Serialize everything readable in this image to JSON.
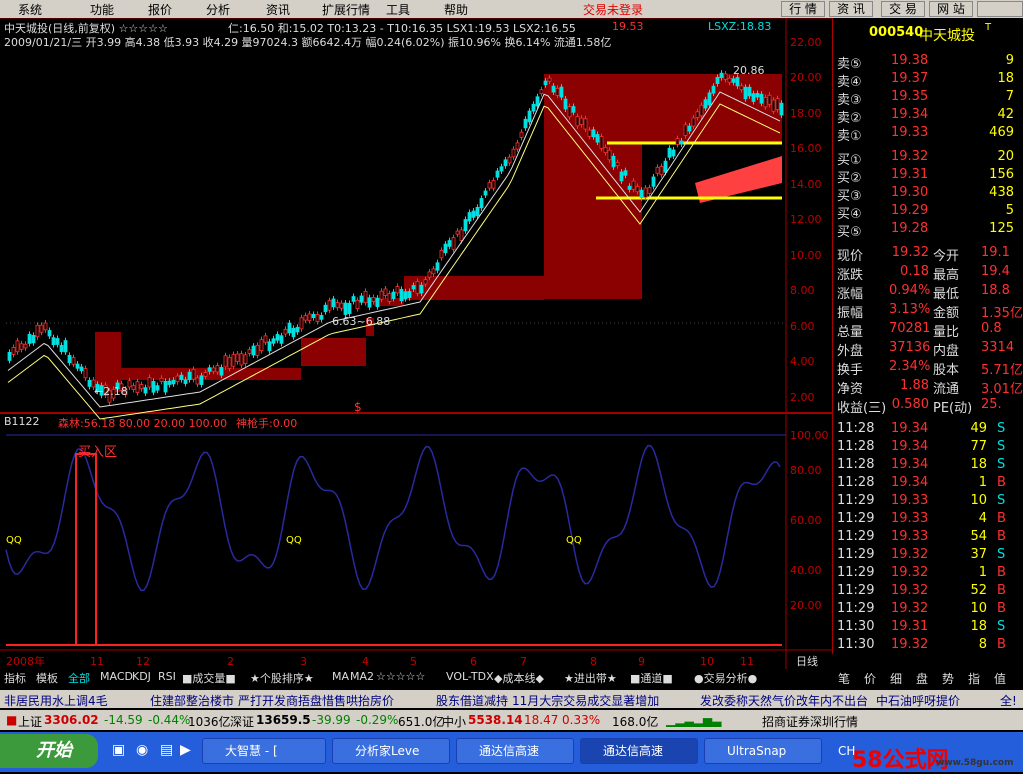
{
  "menu": {
    "items": [
      "系统",
      "功能",
      "报价",
      "分析",
      "资讯",
      "扩展行情",
      "工具",
      "帮助"
    ],
    "status": "交易未登录",
    "nav": [
      "行 情",
      "资 讯",
      "交 易",
      "网 站"
    ]
  },
  "header": {
    "line1": "中天城投(日线,前复权) ☆☆☆☆☆",
    "ma_line": "仁:16.50 和:15.02 T0:13.23 - T10:16.35 LSX1:19.53 LSX2:16.55",
    "ma_last": "19.53",
    "lsxz": "LSXZ:18.83",
    "line2": "2009/01/21/三 开3.99 高4.38 低3.93 收4.29 量97024.3 额6642.4万 幅0.24(6.02%) 振10.96% 换6.14% 流通1.58亿",
    "annotation_low": "←2.18",
    "annotation_high": "20.86",
    "annotation_mid": "6.63~6.88",
    "dollar_mark": "$"
  },
  "indicator": {
    "title": "B1122",
    "params": "森林:56.18 80.00 20.00 100.00",
    "shenqiang": "神枪手:0.00",
    "zone_label": "买入区",
    "qq_marks": [
      "QQ",
      "QQ",
      "QQ"
    ]
  },
  "price_axis": [
    "22.00",
    "20.00",
    "18.00",
    "16.00",
    "14.00",
    "12.00",
    "10.00",
    "8.00",
    "6.00",
    "4.00",
    "2.00"
  ],
  "ind_axis": [
    "100.00",
    "80.00",
    "60.00",
    "40.00",
    "20.00"
  ],
  "time_axis": [
    "2008年",
    "11",
    "12",
    "2",
    "3",
    "4",
    "5",
    "6",
    "7",
    "8",
    "9",
    "10",
    "11"
  ],
  "time_unit": "日线",
  "quote": {
    "code": "000540",
    "name": "中天城投",
    "name_suffix": "T",
    "asks": [
      {
        "label": "卖⑤",
        "price": "19.38",
        "vol": "9"
      },
      {
        "label": "卖④",
        "price": "19.37",
        "vol": "18"
      },
      {
        "label": "卖③",
        "price": "19.35",
        "vol": "7"
      },
      {
        "label": "卖②",
        "price": "19.34",
        "vol": "42"
      },
      {
        "label": "卖①",
        "price": "19.33",
        "vol": "469"
      }
    ],
    "bids": [
      {
        "label": "买①",
        "price": "19.32",
        "vol": "20"
      },
      {
        "label": "买②",
        "price": "19.31",
        "vol": "156"
      },
      {
        "label": "买③",
        "price": "19.30",
        "vol": "438"
      },
      {
        "label": "买④",
        "price": "19.29",
        "vol": "5"
      },
      {
        "label": "买⑤",
        "price": "19.28",
        "vol": "125"
      }
    ],
    "stats": [
      {
        "k1": "现价",
        "v1": "19.32",
        "k2": "今开",
        "v2": "19.1"
      },
      {
        "k1": "涨跌",
        "v1": "0.18",
        "k2": "最高",
        "v2": "19.4"
      },
      {
        "k1": "涨幅",
        "v1": "0.94%",
        "k2": "最低",
        "v2": "18.8"
      },
      {
        "k1": "振幅",
        "v1": "3.13%",
        "k2": "金额",
        "v2": "1.35亿"
      },
      {
        "k1": "总量",
        "v1": "70281",
        "k2": "量比",
        "v2": "0.8"
      },
      {
        "k1": "外盘",
        "v1": "37136",
        "k2": "内盘",
        "v2": "3314"
      },
      {
        "k1": "换手",
        "v1": "2.34%",
        "k2": "股本",
        "v2": "5.71亿"
      },
      {
        "k1": "净资",
        "v1": "1.88",
        "k2": "流通",
        "v2": "3.01亿"
      },
      {
        "k1": "收益(三)",
        "v1": "0.580",
        "k2": "PE(动)",
        "v2": "25."
      }
    ],
    "ticks": [
      {
        "t": "11:28",
        "p": "19.34",
        "v": "49",
        "s": "S"
      },
      {
        "t": "11:28",
        "p": "19.34",
        "v": "77",
        "s": "S"
      },
      {
        "t": "11:28",
        "p": "19.34",
        "v": "18",
        "s": "S"
      },
      {
        "t": "11:28",
        "p": "19.34",
        "v": "1",
        "s": "B"
      },
      {
        "t": "11:29",
        "p": "19.33",
        "v": "10",
        "s": "S"
      },
      {
        "t": "11:29",
        "p": "19.33",
        "v": "4",
        "s": "B"
      },
      {
        "t": "11:29",
        "p": "19.33",
        "v": "54",
        "s": "B"
      },
      {
        "t": "11:29",
        "p": "19.32",
        "v": "37",
        "s": "S"
      },
      {
        "t": "11:29",
        "p": "19.32",
        "v": "1",
        "s": "B"
      },
      {
        "t": "11:29",
        "p": "19.32",
        "v": "52",
        "s": "B"
      },
      {
        "t": "11:29",
        "p": "19.32",
        "v": "10",
        "s": "B"
      },
      {
        "t": "11:30",
        "p": "19.31",
        "v": "18",
        "s": "S"
      },
      {
        "t": "11:30",
        "p": "19.32",
        "v": "8",
        "s": "B"
      }
    ],
    "bottom_tabs": [
      "笔",
      "价",
      "细",
      "盘",
      "势",
      "指",
      "值"
    ]
  },
  "chart_tabs": [
    "指标",
    "模板",
    "全部",
    "MACD",
    "KDJ",
    "RSI",
    "■成交量■",
    "★个股排序★",
    "MA",
    "MA2",
    "☆☆☆☆☆",
    "VOL-TDX",
    "◆成本线◆",
    "★进出带★",
    "■通道■",
    "●交易分析●"
  ],
  "news": [
    "非居民用水上调4毛",
    "住建部整治楼市",
    "严打开发商捂盘惜售哄抬房价",
    "股东借道减持",
    "11月大宗交易成交显著增加",
    "发改委称天然气价改年内不出台",
    "中石油呼呀提价",
    "全!"
  ],
  "index_bar": {
    "sh_label": "上证",
    "sh_val": "3306.02",
    "sh_chg": "-14.59",
    "sh_pct": "-0.44%",
    "sh_amt": "1036亿",
    "sz_label": "深证",
    "sz_val": "13659.5",
    "sz_chg": "-39.99",
    "sz_pct": "-0.29%",
    "sz_amt": "651.0亿",
    "zx_label": "中小",
    "zx_val": "5538.14",
    "zx_chg": "18.47",
    "zx_pct": "0.33%",
    "zx_amt": "168.0亿",
    "broker": "招商证券深圳行情"
  },
  "taskbar": {
    "start": "开始",
    "buttons": [
      "大智慧 - [",
      "分析家Leve",
      "通达信高速",
      "通达信高速",
      "UltraSnap"
    ],
    "tray": "CH",
    "watermark": "58公式网",
    "watermark_url": "www.58gu.com"
  },
  "colors": {
    "up": "#ff3030",
    "down": "#00e0e0",
    "yellow": "#ffff00",
    "band": "#8b0000",
    "axis": "#a00000",
    "ind_line": "#2a2aa0"
  }
}
